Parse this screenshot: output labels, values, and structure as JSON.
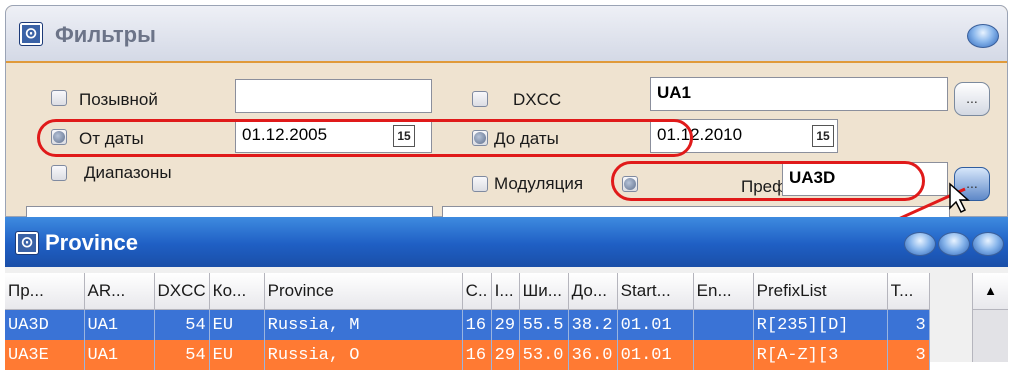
{
  "filters": {
    "title": "Фильтры",
    "rows": {
      "callsign": {
        "label": "Позывной",
        "value": ""
      },
      "from_date": {
        "label": "От даты",
        "value": "01.12.2005"
      },
      "bands": {
        "label": "Диапазоны"
      },
      "dxcc": {
        "label": "DXCC",
        "value": "UA1"
      },
      "to_date": {
        "label": "До даты",
        "value": "01.12.2010"
      },
      "mode": {
        "label": "Модуляция"
      },
      "prefix": {
        "label": "Преф",
        "value": "UA3D"
      }
    },
    "calendar_glyph": "15",
    "ellipsis": "..."
  },
  "province": {
    "title": "Province",
    "columns": [
      "Пр...",
      "AR...",
      "DXCC",
      "Ко...",
      "Province",
      "C..",
      "I...",
      "Ши...",
      "До...",
      "Start...",
      "En...",
      "PrefixList",
      "T..."
    ],
    "rows": [
      [
        "UA3D",
        "UA1",
        "54",
        "EU",
        "Russia, M",
        "16",
        "29",
        "55.5",
        "38.2",
        "01.01",
        "",
        "R[235][D]",
        "3"
      ],
      [
        "UA3E",
        "UA1",
        "54",
        "EU",
        "Russia, O",
        "16",
        "29",
        "53.0",
        "36.0",
        "01.01",
        "",
        "R[A-Z][3",
        "3"
      ]
    ],
    "scroll_up": "▲"
  },
  "colors": {
    "highlight_oval": "#e01a1a",
    "selected_row": "#3a73d6",
    "alt_row": "#ff7a33"
  }
}
